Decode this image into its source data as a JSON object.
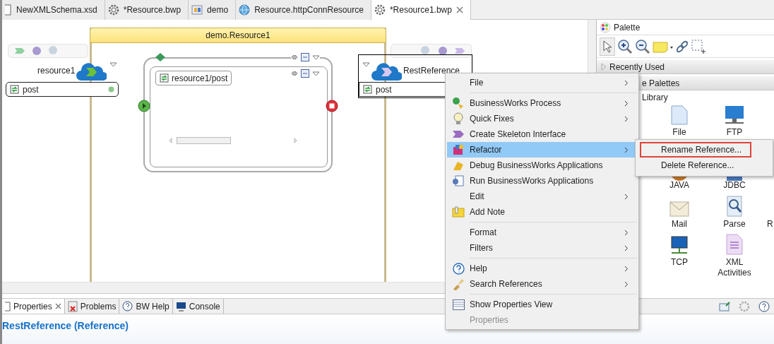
{
  "editor_tabs": [
    {
      "label": "NewXMLSchema.xsd",
      "selected": false
    },
    {
      "label": "*Resource.bwp",
      "selected": false
    },
    {
      "label": "demo",
      "selected": false
    },
    {
      "label": "Resource.httpConnResource",
      "selected": false
    },
    {
      "label": "*Resource1.bwp",
      "selected": true
    }
  ],
  "canvas": {
    "process_title": "demo.Resource1",
    "service": {
      "name": "resource1",
      "operation": "post"
    },
    "scope": {
      "label": "resource1/post"
    },
    "reference": {
      "name": "RestReference",
      "operation": "post",
      "selected": true
    }
  },
  "palette": {
    "title": "Palette",
    "drawers": [
      "Recently Used",
      "e Palettes"
    ],
    "library_label": "Library",
    "rows": [
      [
        {
          "label": "File"
        },
        {
          "label": "FTP"
        }
      ],
      [
        {
          "label": "JAVA"
        },
        {
          "label": "JDBC"
        }
      ],
      [
        {
          "label": "Mail"
        },
        {
          "label": "Parse"
        },
        {
          "label": "R"
        }
      ],
      [
        {
          "label": "TCP"
        },
        {
          "label": "XML Activities"
        }
      ]
    ]
  },
  "context_menu": [
    {
      "kind": "item",
      "label": "File",
      "submenu": true,
      "selected": false,
      "disabled": false
    },
    {
      "kind": "separator"
    },
    {
      "kind": "item",
      "label": "BusinessWorks Process",
      "submenu": true,
      "selected": false,
      "disabled": false
    },
    {
      "kind": "item",
      "label": "Quick Fixes",
      "submenu": true,
      "selected": false,
      "disabled": false
    },
    {
      "kind": "item",
      "label": "Create Skeleton Interface",
      "submenu": false,
      "selected": false,
      "disabled": false
    },
    {
      "kind": "item",
      "label": "Refactor",
      "submenu": true,
      "selected": true,
      "disabled": false
    },
    {
      "kind": "item",
      "label": "Debug BusinessWorks Applications",
      "submenu": false,
      "selected": false,
      "disabled": false
    },
    {
      "kind": "item",
      "label": "Run BusinessWorks Applications",
      "submenu": false,
      "selected": false,
      "disabled": false
    },
    {
      "kind": "item",
      "label": "Edit",
      "submenu": true,
      "selected": false,
      "disabled": false
    },
    {
      "kind": "item",
      "label": "Add Note",
      "submenu": false,
      "selected": false,
      "disabled": false
    },
    {
      "kind": "separator"
    },
    {
      "kind": "item",
      "label": "Format",
      "submenu": true,
      "selected": false,
      "disabled": false
    },
    {
      "kind": "item",
      "label": "Filters",
      "submenu": true,
      "selected": false,
      "disabled": false
    },
    {
      "kind": "separator"
    },
    {
      "kind": "item",
      "label": "Help",
      "submenu": true,
      "selected": false,
      "disabled": false
    },
    {
      "kind": "item",
      "label": "Search References",
      "submenu": true,
      "selected": false,
      "disabled": false
    },
    {
      "kind": "separator"
    },
    {
      "kind": "item",
      "label": "Show Properties View",
      "submenu": false,
      "selected": false,
      "disabled": false
    },
    {
      "kind": "item",
      "label": "Properties",
      "submenu": false,
      "selected": false,
      "disabled": true
    }
  ],
  "submenu": [
    {
      "label": "Rename Reference...",
      "highlighted": true
    },
    {
      "label": "Delete Reference...",
      "highlighted": false
    }
  ],
  "bottom_tabs": [
    {
      "label": "Properties",
      "selected": true
    },
    {
      "label": "Problems",
      "selected": false
    },
    {
      "label": "BW Help",
      "selected": false
    },
    {
      "label": "Console",
      "selected": false
    }
  ],
  "properties_title": "RestReference (Reference)"
}
